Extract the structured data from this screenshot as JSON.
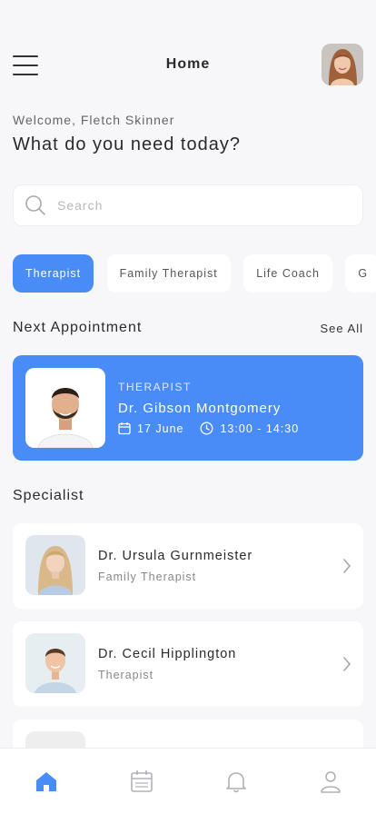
{
  "header": {
    "title": "Home"
  },
  "greeting": {
    "welcome": "Welcome, Fletch Skinner",
    "headline": "What do you need today?"
  },
  "search": {
    "placeholder": "Search"
  },
  "categories": [
    {
      "label": "Therapist",
      "active": true
    },
    {
      "label": "Family Therapist",
      "active": false
    },
    {
      "label": "Life Coach",
      "active": false
    },
    {
      "label": "G",
      "active": false
    }
  ],
  "next_appointment": {
    "section_title": "Next Appointment",
    "see_all": "See All",
    "role": "THERAPIST",
    "doctor": "Dr. Gibson Montgomery",
    "date": "17 June",
    "time": "13:00 - 14:30"
  },
  "specialist": {
    "section_title": "Specialist",
    "items": [
      {
        "name": "Dr. Ursula Gurnmeister",
        "role": "Family Therapist"
      },
      {
        "name": "Dr. Cecil Hipplington",
        "role": "Therapist"
      }
    ]
  },
  "tabbar": {
    "icons": [
      "home-icon",
      "calendar-icon",
      "bell-icon",
      "profile-icon"
    ]
  },
  "colors": {
    "accent": "#4a8cf7",
    "background": "#f7f7f9",
    "card": "#ffffff"
  }
}
